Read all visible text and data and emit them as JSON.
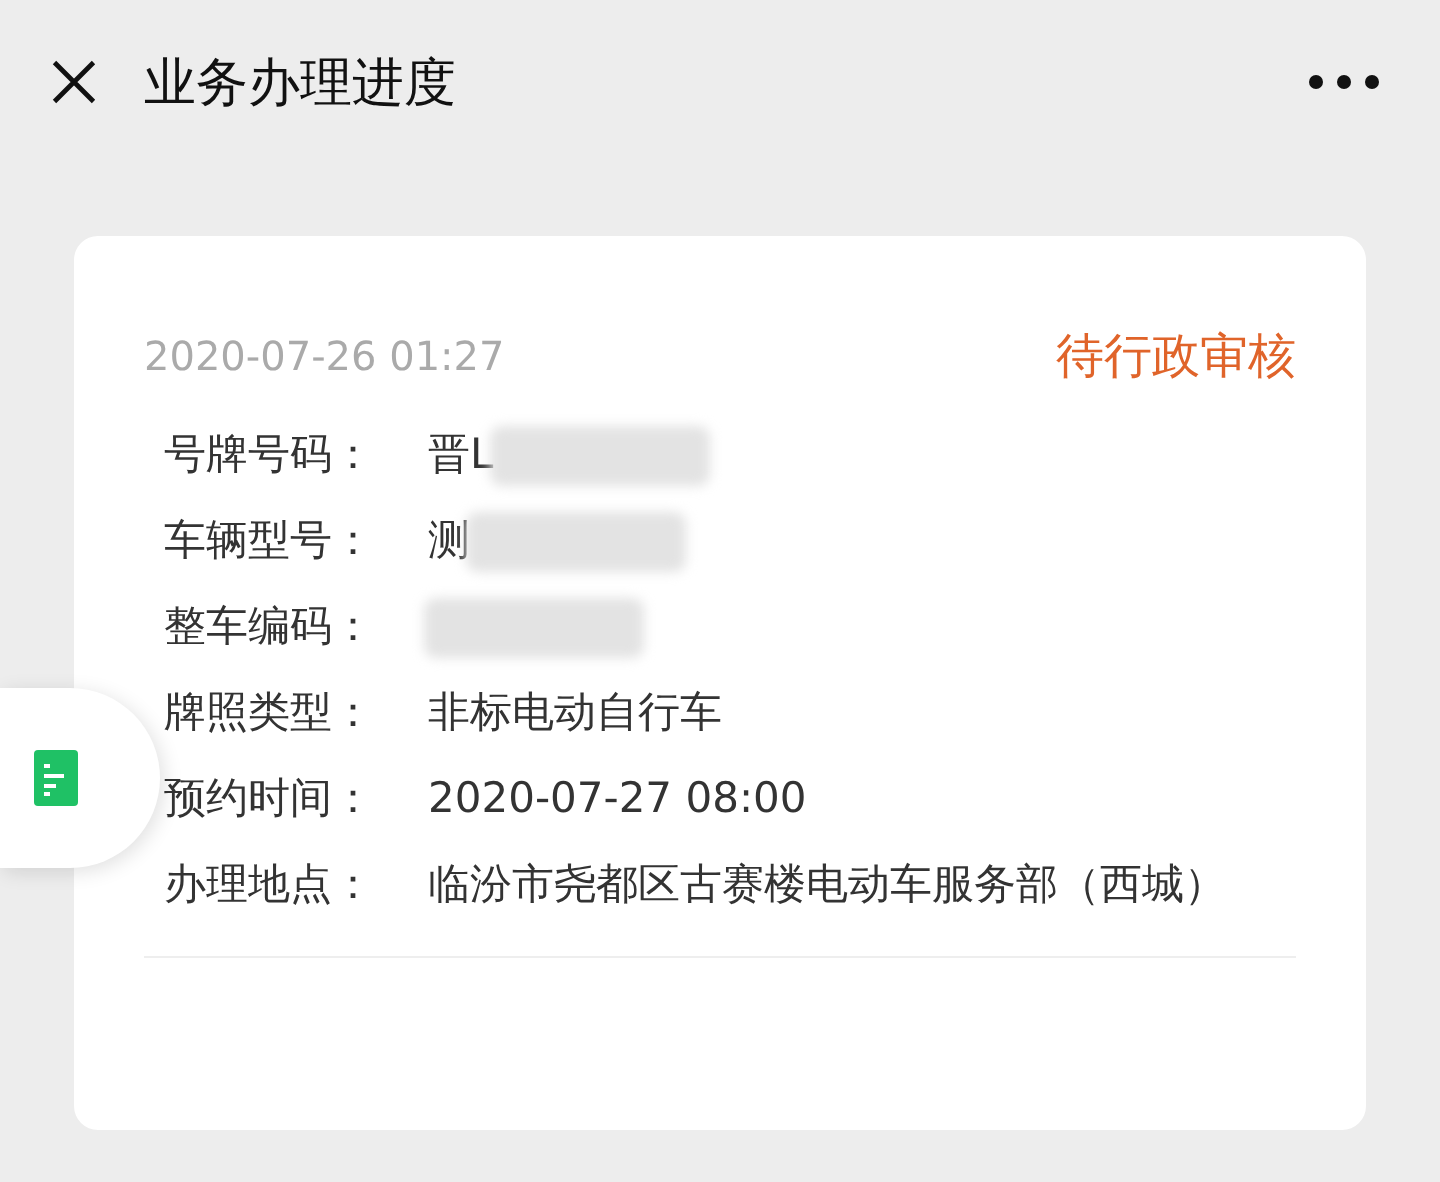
{
  "header": {
    "title": "业务办理进度"
  },
  "card": {
    "time": "2020-07-26 01:27",
    "status": "待行政审核",
    "fields": [
      {
        "label": "号牌号码：",
        "value": "晋L",
        "redacted": true
      },
      {
        "label": "车辆型号：",
        "value": "测",
        "redacted": true
      },
      {
        "label": "整车编码：",
        "redacted": true
      },
      {
        "label": "牌照类型：",
        "value": "非标电动自行车",
        "redacted": false
      },
      {
        "label": "预约时间：",
        "value": "2020-07-27 08:00",
        "redacted": false
      },
      {
        "label": "办理地点：",
        "value": "临汾市尧都区古赛楼电动车服务部（西城）",
        "redacted": false
      }
    ]
  }
}
